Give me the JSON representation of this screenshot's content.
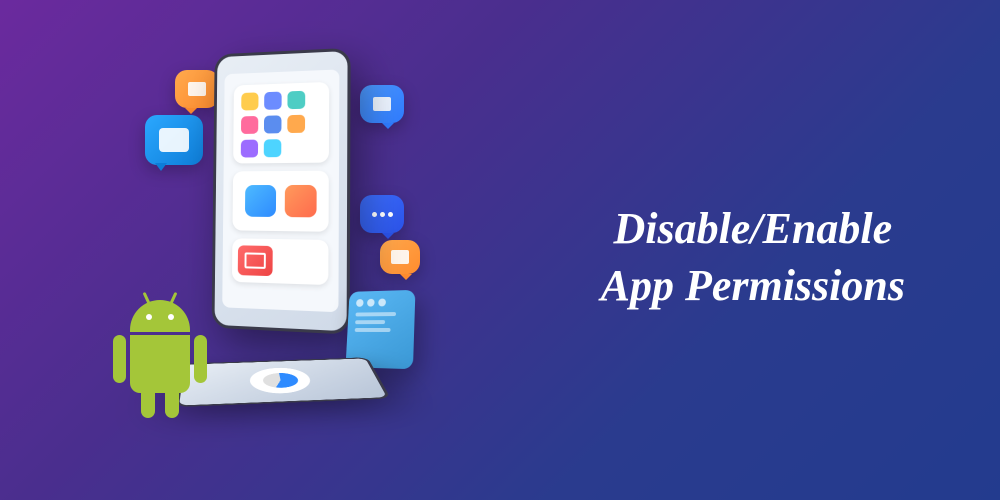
{
  "title": {
    "line1": "Disable/Enable",
    "line2": "App Permissions"
  }
}
